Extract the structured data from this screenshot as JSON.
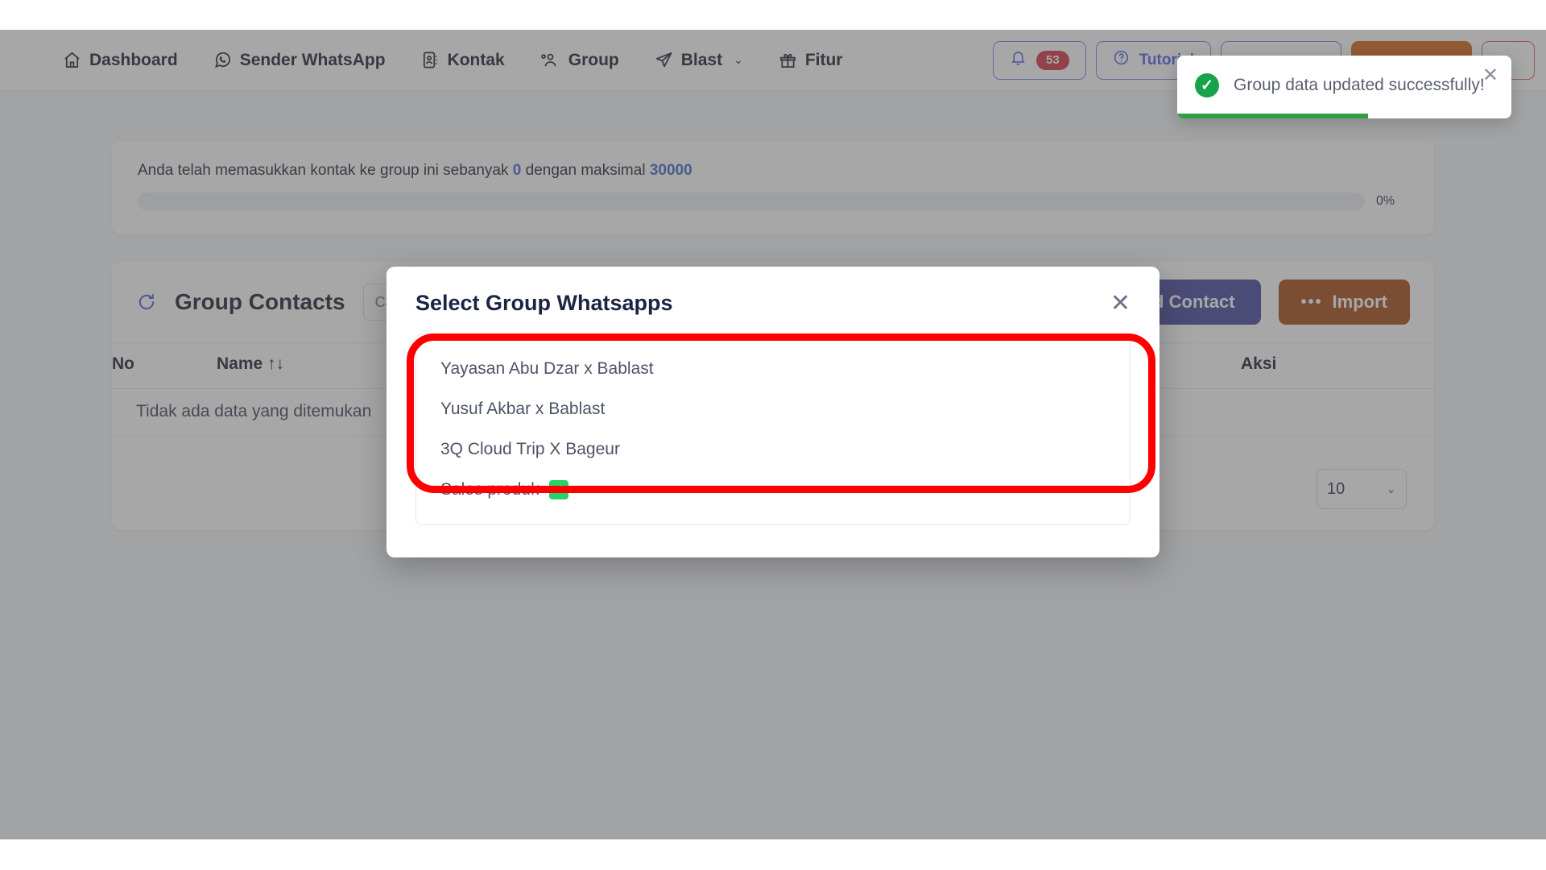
{
  "navbar": {
    "items": [
      {
        "label": "Dashboard",
        "icon": "home-icon",
        "caret": false
      },
      {
        "label": "Sender WhatsApp",
        "icon": "whatsapp-icon",
        "caret": false
      },
      {
        "label": "Kontak",
        "icon": "contact-card-icon",
        "caret": false
      },
      {
        "label": "Group",
        "icon": "people-icon",
        "caret": false
      },
      {
        "label": "Blast",
        "icon": "send-icon",
        "caret": true
      },
      {
        "label": "Fitur",
        "icon": "gift-icon",
        "caret": false
      }
    ],
    "caret_glyph": "⌄",
    "notification": {
      "icon": "bell-icon",
      "count": "53"
    },
    "tutorial": {
      "icon": "question-circle-icon",
      "label": "Tutorial"
    },
    "secondary_button_label": "",
    "primary_button_label": "",
    "danger_button_label": ""
  },
  "quota": {
    "text_prefix": "Anda telah memasukkan kontak ke group ini sebanyak ",
    "used": "0",
    "text_middle": " dengan maksimal ",
    "max": "30000",
    "percent_label": "0%",
    "percent_value": 0
  },
  "table_card": {
    "refresh_icon": "refresh-icon",
    "title": "Group Contacts",
    "search_placeholder": "Cari...",
    "search_value": "",
    "add_contact_label": "Add Contact",
    "import_label": "Import",
    "import_dots": "•••",
    "columns": [
      "No",
      "Name",
      "",
      "Aksi"
    ],
    "sort_glyph": "↑↓",
    "empty_message": "Tidak ada data yang ditemukan",
    "page_size": "10",
    "page_size_chevron": "⌄"
  },
  "modal": {
    "title": "Select Group Whatsapps",
    "close_glyph": "✕",
    "groups": [
      {
        "name": "Yayasan Abu Dzar x Bablast",
        "selected": false
      },
      {
        "name": "Yusuf Akbar x Bablast",
        "selected": false
      },
      {
        "name": "3Q Cloud Trip X Bageur",
        "selected": false
      },
      {
        "name": "Sales produk",
        "selected": true
      }
    ],
    "check_glyph": "✓"
  },
  "toast": {
    "icon": "check-circle-icon",
    "icon_glyph": "✓",
    "message": "Group data updated successfully!",
    "close_glyph": "✕",
    "progress_percent": 57
  },
  "colors": {
    "accent_indigo": "#3f3f9e",
    "accent_blue": "#4a5ae8",
    "import_orange": "#a4430e",
    "nav_orange": "#d4600f",
    "danger_red": "#d22d3d",
    "success_green": "#16a34a",
    "whatsapp_green": "#25d366",
    "annotation_red": "#ff0000"
  }
}
